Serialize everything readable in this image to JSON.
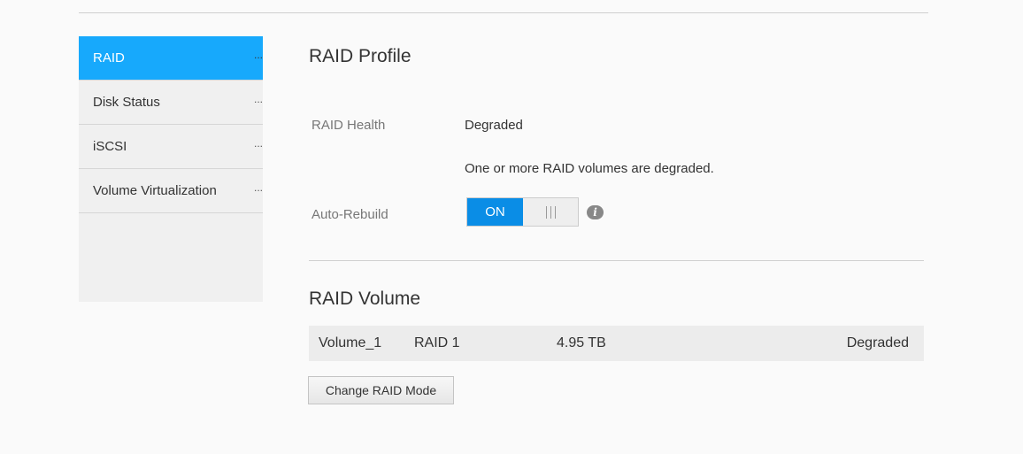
{
  "sidebar": {
    "items": [
      {
        "label": "RAID"
      },
      {
        "label": "Disk Status"
      },
      {
        "label": "iSCSI"
      },
      {
        "label": "Volume Virtualization"
      }
    ],
    "ellipsis": "..."
  },
  "profile": {
    "title": "RAID Profile",
    "health_label": "RAID Health",
    "health_value": "Degraded",
    "health_message": "One or more RAID volumes are degraded.",
    "rebuild_label": "Auto-Rebuild",
    "toggle_on": "ON",
    "info_icon": "i"
  },
  "volume": {
    "title": "RAID Volume",
    "rows": [
      {
        "name": "Volume_1",
        "type": "RAID 1",
        "size": "4.95 TB",
        "status": "Degraded"
      }
    ],
    "change_button": "Change RAID Mode"
  },
  "colors": {
    "accent": "#17a9fc",
    "toggle": "#0a8de6"
  }
}
